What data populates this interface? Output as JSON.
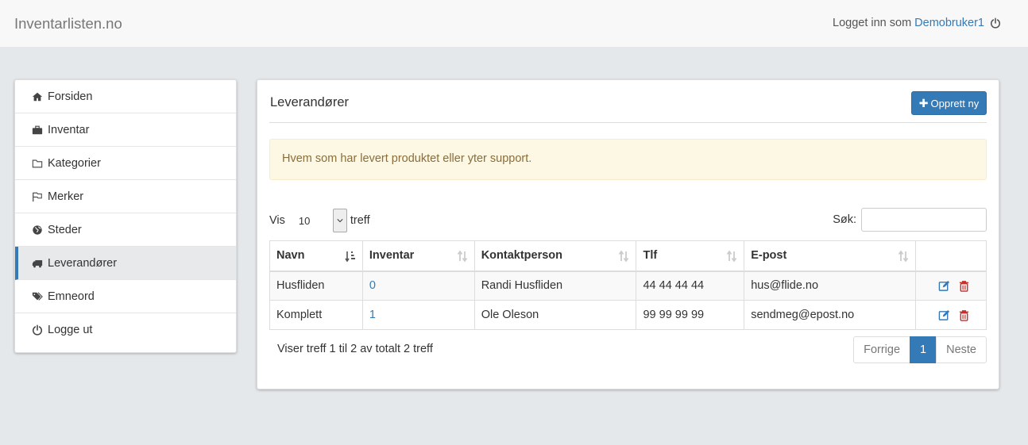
{
  "header": {
    "brand": "Inventarlisten.no",
    "logged_in_prefix": "Logget inn som",
    "username": "Demobruker1"
  },
  "sidebar": {
    "items": [
      {
        "label": "Forsiden",
        "icon": "home-icon"
      },
      {
        "label": "Inventar",
        "icon": "briefcase-icon"
      },
      {
        "label": "Kategorier",
        "icon": "folder-icon"
      },
      {
        "label": "Merker",
        "icon": "flag-icon"
      },
      {
        "label": "Steder",
        "icon": "globe-icon"
      },
      {
        "label": "Leverandører",
        "icon": "truck-icon",
        "active": true
      },
      {
        "label": "Emneord",
        "icon": "tags-icon"
      },
      {
        "label": "Logge ut",
        "icon": "power-icon"
      }
    ]
  },
  "main": {
    "title": "Leverandører",
    "new_button": "Opprett ny",
    "alert": "Hvem som har levert produktet eller yter support.",
    "length": {
      "prefix": "Vis",
      "value": "10",
      "suffix": "treff"
    },
    "search_label": "Søk:",
    "columns": [
      "Navn",
      "Inventar",
      "Kontaktperson",
      "Tlf",
      "E-post"
    ],
    "rows": [
      {
        "navn": "Husfliden",
        "inventar": "0",
        "kontakt": "Randi Husfliden",
        "tlf": "44 44 44 44",
        "epost": "hus@flide.no"
      },
      {
        "navn": "Komplett",
        "inventar": "1",
        "kontakt": "Ole Oleson",
        "tlf": "99 99 99 99",
        "epost": "sendmeg@epost.no"
      }
    ],
    "info": "Viser treff 1 til 2 av totalt 2 treff",
    "pager": {
      "prev": "Forrige",
      "current": "1",
      "next": "Neste"
    }
  },
  "colors": {
    "accent": "#337ab7",
    "delete": "#c9302c",
    "alert_bg": "#fcf8e3"
  }
}
